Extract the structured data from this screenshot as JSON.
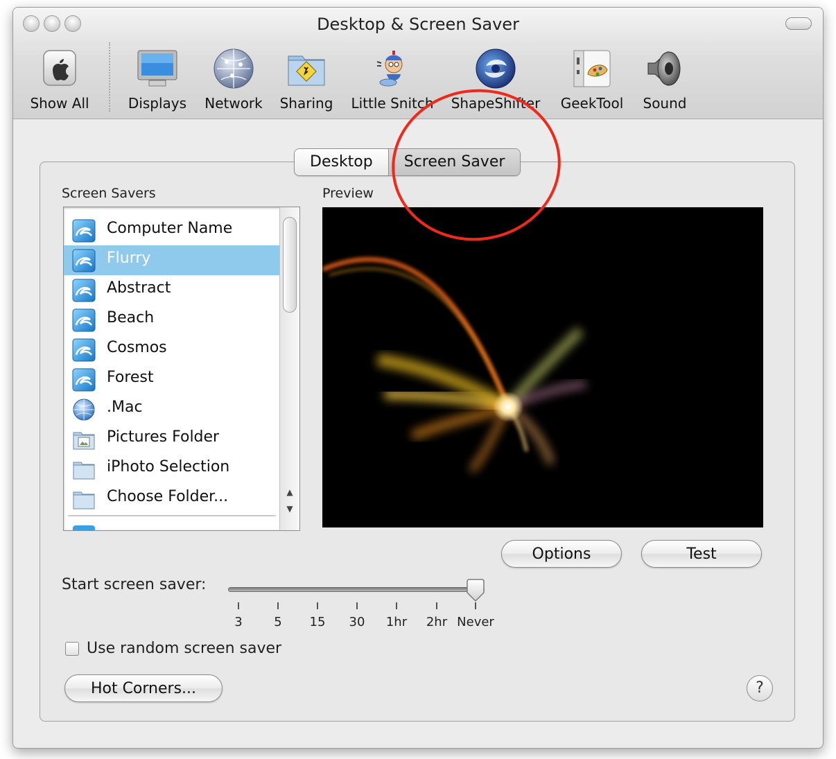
{
  "window": {
    "title": "Desktop & Screen Saver"
  },
  "toolbar": {
    "show_all": {
      "label": "Show All",
      "icon": "apple-logo-icon"
    },
    "items": [
      {
        "label": "Displays",
        "icon": "display-monitor-icon"
      },
      {
        "label": "Network",
        "icon": "network-globe-icon"
      },
      {
        "label": "Sharing",
        "icon": "sharing-folder-icon"
      },
      {
        "label": "Little Snitch",
        "icon": "little-snitch-icon"
      },
      {
        "label": "ShapeShifter",
        "icon": "shapeshifter-icon"
      },
      {
        "label": "GeekTool",
        "icon": "geektool-icon"
      },
      {
        "label": "Sound",
        "icon": "speaker-icon"
      }
    ]
  },
  "tabs": [
    {
      "label": "Desktop",
      "active": false
    },
    {
      "label": "Screen Saver",
      "active": true
    }
  ],
  "screen_savers": {
    "heading": "Screen Savers",
    "items": [
      {
        "label": "Computer Name",
        "icon": "screensaver-swirl-icon",
        "selected": false
      },
      {
        "label": "Flurry",
        "icon": "screensaver-swirl-icon",
        "selected": true
      },
      {
        "label": "Abstract",
        "icon": "screensaver-swirl-icon",
        "selected": false
      },
      {
        "label": "Beach",
        "icon": "screensaver-swirl-icon",
        "selected": false
      },
      {
        "label": "Cosmos",
        "icon": "screensaver-swirl-icon",
        "selected": false
      },
      {
        "label": "Forest",
        "icon": "screensaver-swirl-icon",
        "selected": false
      },
      {
        "label": ".Mac",
        "icon": "dotmac-globe-icon",
        "selected": false
      },
      {
        "label": "Pictures Folder",
        "icon": "pictures-folder-icon",
        "selected": false
      },
      {
        "label": "iPhoto Selection",
        "icon": "folder-icon",
        "selected": false
      },
      {
        "label": "Choose Folder...",
        "icon": "folder-icon",
        "selected": false
      }
    ]
  },
  "preview": {
    "heading": "Preview"
  },
  "buttons": {
    "options": "Options",
    "test": "Test",
    "hot_corners": "Hot Corners...",
    "help": "?"
  },
  "start_saver": {
    "label": "Start screen saver:",
    "ticks": [
      "3",
      "5",
      "15",
      "30",
      "1hr",
      "2hr",
      "Never"
    ],
    "value": "Never"
  },
  "random": {
    "label": "Use random screen saver",
    "checked": false
  },
  "annotation": {
    "color": "#ef2a1a"
  },
  "colors": {
    "selection": "#8fc9ec",
    "annotation_red": "#ef2a1a"
  }
}
